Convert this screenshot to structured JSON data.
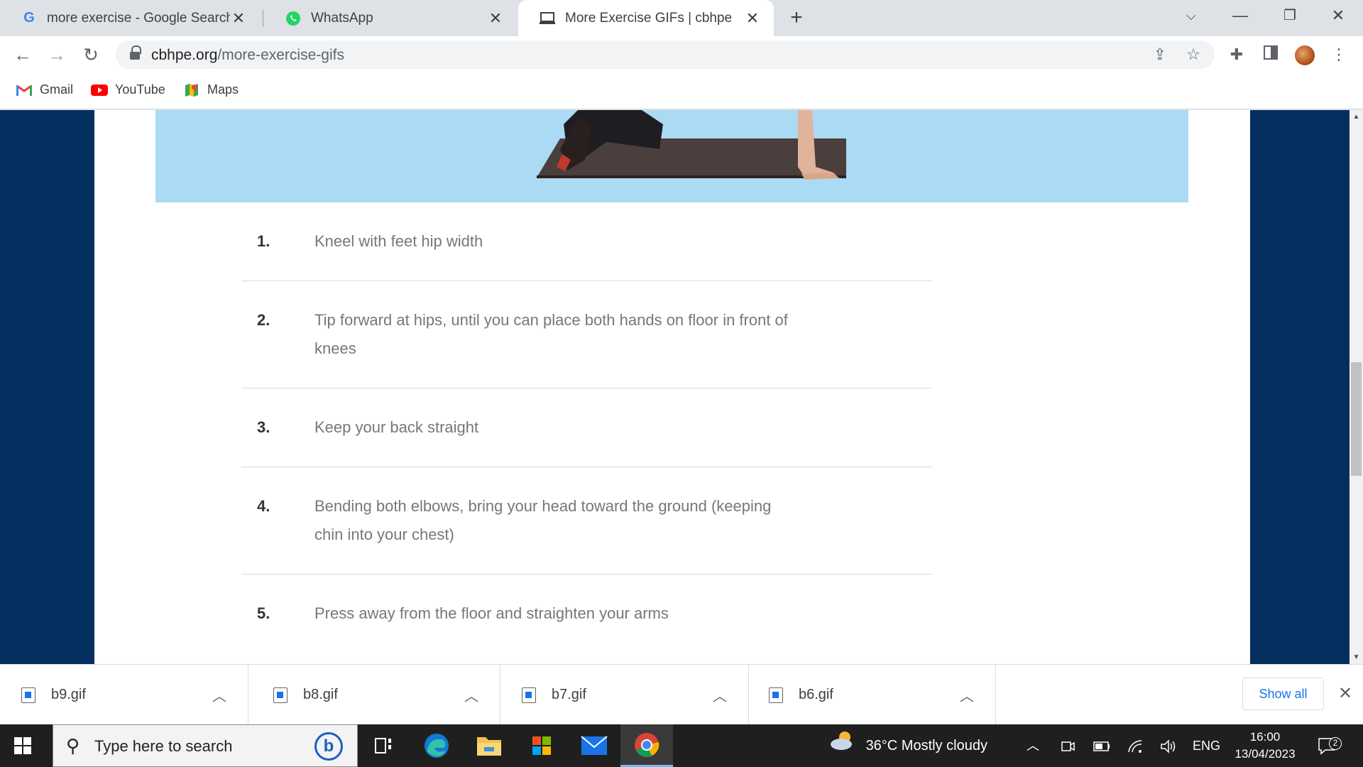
{
  "browser": {
    "tabs": [
      {
        "title": "more exercise - Google Search",
        "icon": "google-icon"
      },
      {
        "title": "WhatsApp",
        "icon": "whatsapp-icon"
      },
      {
        "title": "More Exercise GIFs | cbhpe",
        "icon": "site-icon",
        "active": true
      }
    ],
    "address": {
      "domain": "cbhpe.org",
      "path": "/more-exercise-gifs"
    },
    "bookmarks": [
      {
        "label": "Gmail",
        "icon": "gmail-icon"
      },
      {
        "label": "YouTube",
        "icon": "youtube-icon"
      },
      {
        "label": "Maps",
        "icon": "maps-icon"
      }
    ]
  },
  "page": {
    "steps": [
      {
        "num": "1.",
        "text": "Kneel with feet hip width"
      },
      {
        "num": "2.",
        "text": "Tip forward at hips, until you can place both hands on floor in front of knees"
      },
      {
        "num": "3.",
        "text": "Keep your back straight"
      },
      {
        "num": "4.",
        "text": "Bending both elbows, bring your head toward the ground (keeping chin into your chest)"
      },
      {
        "num": "5.",
        "text": "Press away from the floor and straighten your arms"
      }
    ],
    "colors": {
      "background": "#052f5f",
      "hero": "#abdaf5"
    }
  },
  "downloads": {
    "items": [
      {
        "name": "b9.gif"
      },
      {
        "name": "b8.gif"
      },
      {
        "name": "b7.gif"
      },
      {
        "name": "b6.gif"
      }
    ],
    "show_all": "Show all"
  },
  "taskbar": {
    "search_placeholder": "Type here to search",
    "weather": "36°C  Mostly cloudy",
    "language": "ENG",
    "time": "16:00",
    "date": "13/04/2023",
    "notifications": "2"
  }
}
